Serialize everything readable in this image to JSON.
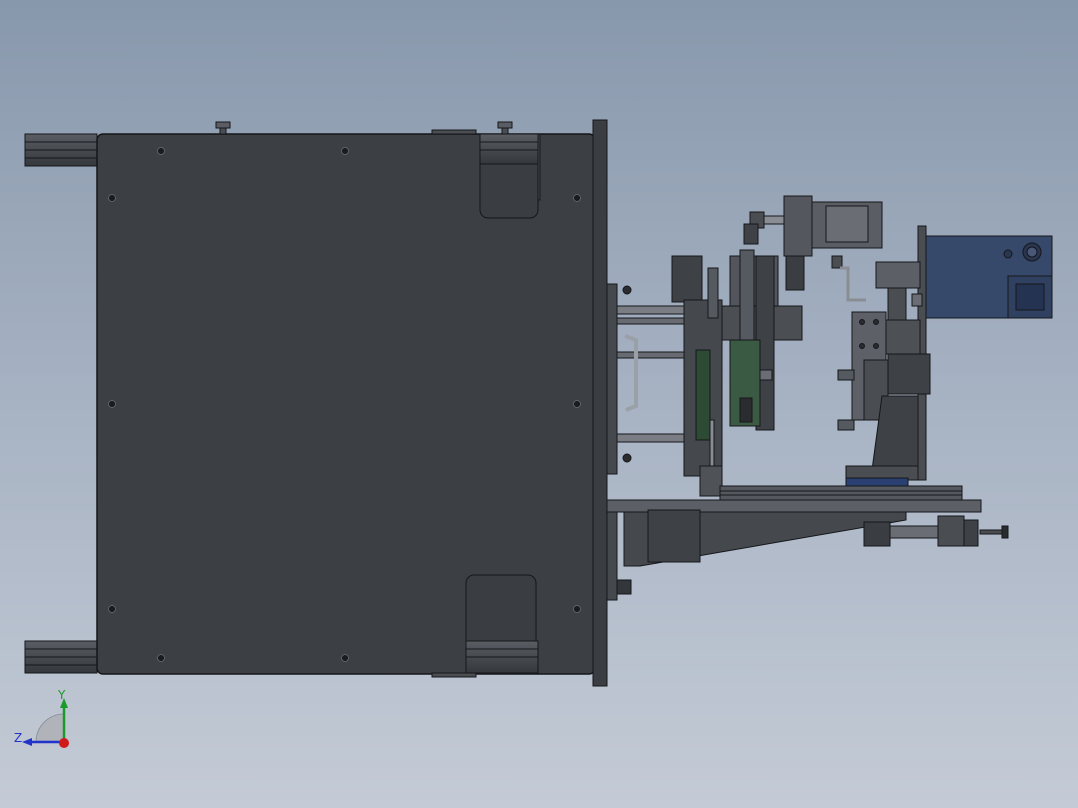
{
  "viewport": {
    "background_top": "#8898ac",
    "background_bottom": "#c4cbd6",
    "model_base_color": "#3c3f44",
    "model_edge_color": "#15171a",
    "motor_color": "#36496a",
    "accent_blue": "#2a3f72"
  },
  "triad": {
    "y_label": "Y",
    "z_label": "Z",
    "y_color": "#1a9a2a",
    "z_color": "#2233cc",
    "x_color": "#d11a1a"
  },
  "icons": {
    "triad": "coordinate-triad-icon"
  }
}
